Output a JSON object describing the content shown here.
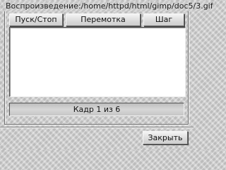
{
  "frame": {
    "title": "Воспроизведение:/home/httpd/html/gimp/doc5/3.gif"
  },
  "toolbar": {
    "play_stop_label": "Пуск/Стоп",
    "rewind_label": "Перемотка",
    "step_label": "Шаг"
  },
  "status": {
    "frame_text": "Кадр 1 из 6"
  },
  "footer": {
    "close_label": "Закрыть"
  }
}
